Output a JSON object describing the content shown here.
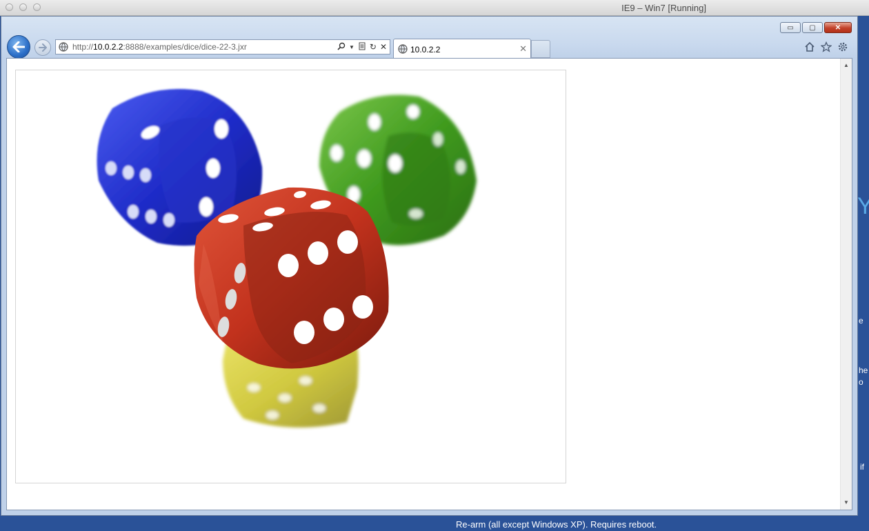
{
  "mac_window": {
    "title": "IE9 – Win7 [Running]"
  },
  "browser": {
    "address": {
      "scheme": "http://",
      "host": "10.0.2.2",
      "rest": ":8888/examples/dice/dice-22-3.jxr"
    },
    "tab": {
      "label": "10.0.2.2"
    },
    "window_controls": {
      "minimize": "▭",
      "restore": "▢",
      "close": "✕"
    }
  },
  "content": {
    "image_name": "dice image",
    "dice": [
      {
        "color": "#1e2fd6",
        "name": "blue die"
      },
      {
        "color": "#3f9a1e",
        "name": "green die"
      },
      {
        "color": "#c2321d",
        "name": "red die"
      },
      {
        "color": "#c9c020",
        "name": "yellow die"
      }
    ]
  },
  "desktop": {
    "bottom_text": "Re-arm (all except Windows XP). Requires reboot.",
    "side_fragments": [
      "e",
      "he",
      "o",
      "if"
    ],
    "accent_text": "Y"
  }
}
